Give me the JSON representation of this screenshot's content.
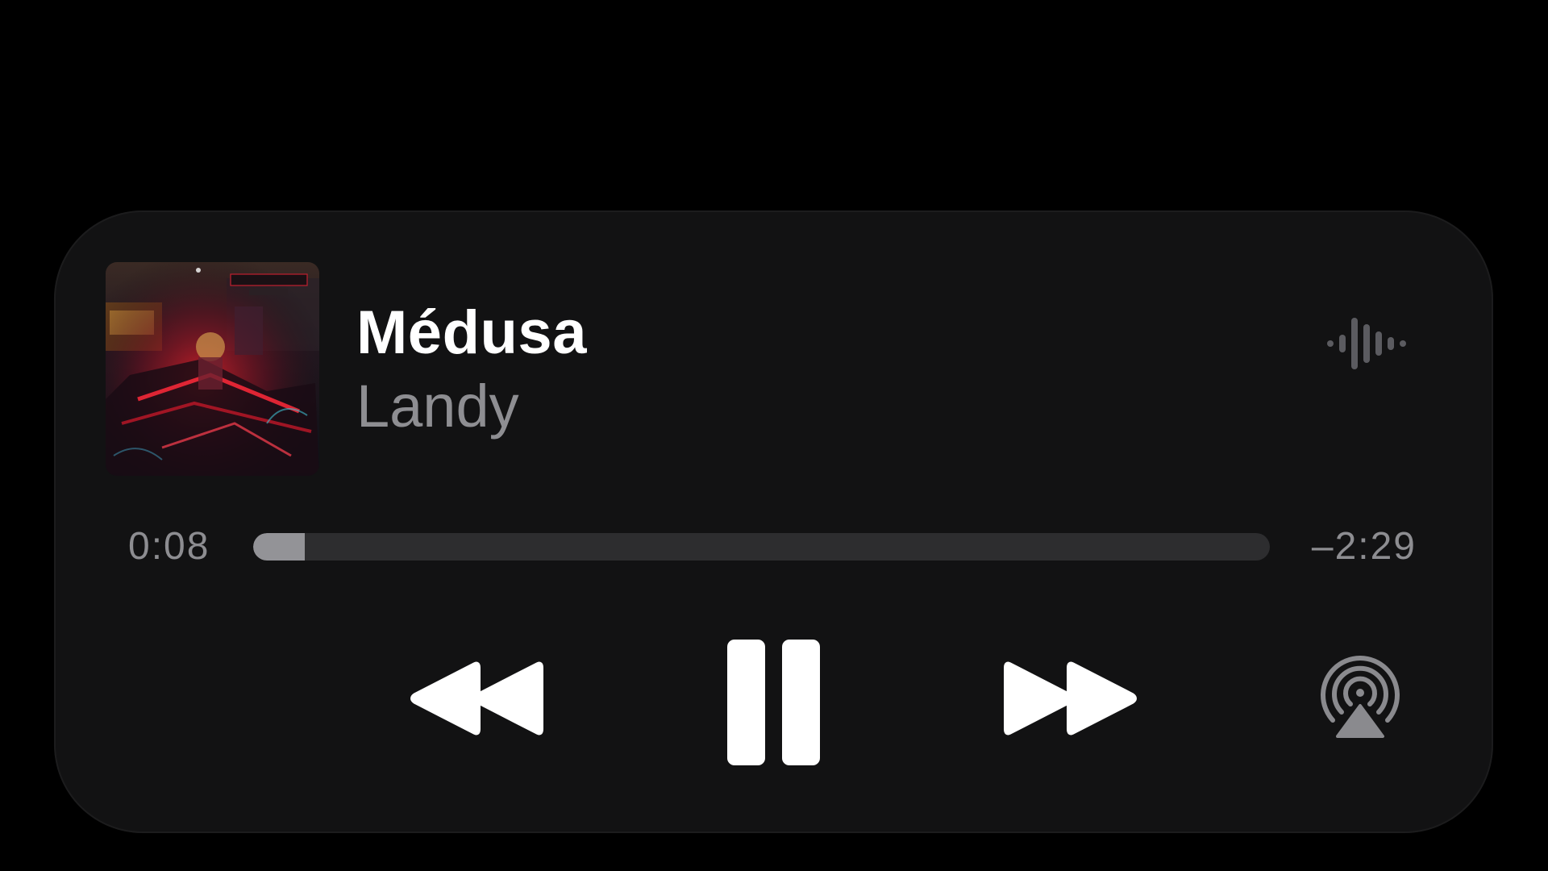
{
  "track": {
    "title": "Médusa",
    "artist": "Landy"
  },
  "progress": {
    "elapsed": "0:08",
    "remaining": "–2:29",
    "fraction": 0.051
  },
  "controls": {
    "rewind_icon": "backward-icon",
    "pause_icon": "pause-icon",
    "forward_icon": "forward-icon",
    "airplay_icon": "airplay-icon",
    "waveform_icon": "audio-waveform-icon"
  },
  "colors": {
    "background": "#000000",
    "card": "#121213",
    "title": "#ffffff",
    "secondary": "#8e8e92",
    "track": "#2d2d2f",
    "fill": "#939397"
  }
}
